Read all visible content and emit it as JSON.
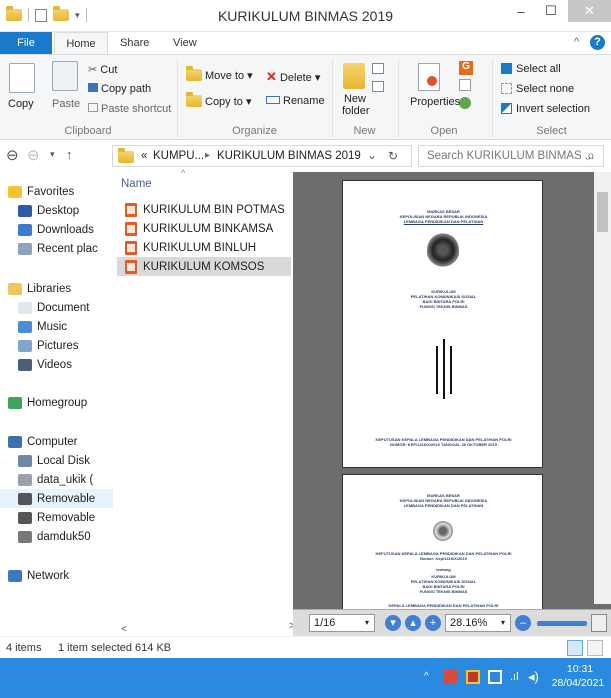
{
  "window": {
    "title": "KURIKULUM BINMAS 2019"
  },
  "title_controls": {
    "minimize": "–",
    "maximize": "☐",
    "close": "✕"
  },
  "ribbon_tabs": [
    "File",
    "Home",
    "Share",
    "View"
  ],
  "ribbon": {
    "clipboard": {
      "label": "Clipboard",
      "copy": "Copy",
      "paste": "Paste",
      "cut": "Cut",
      "copy_path": "Copy path",
      "paste_shortcut": "Paste shortcut"
    },
    "organize": {
      "label": "Organize",
      "move_to": "Move to ▾",
      "copy_to": "Copy to ▾",
      "delete": "Delete ▾",
      "rename": "Rename"
    },
    "new": {
      "label": "New",
      "new_folder_1": "New",
      "new_folder_2": "folder"
    },
    "open": {
      "label": "Open",
      "properties": "Properties"
    },
    "select": {
      "label": "Select",
      "select_all": "Select all",
      "select_none": "Select none",
      "invert": "Invert selection"
    }
  },
  "address": {
    "path_prefix": "«",
    "path_1": "KUMPU...",
    "path_arrow": "▸",
    "path_2": "KURIKULUM BINMAS 2019",
    "dropdown": "⌄",
    "refresh": "↻",
    "search_placeholder": "Search KURIKULUM BINMAS ...",
    "search_icon": "⌕"
  },
  "nav_buttons": {
    "back": "⊖",
    "forward": "⊖",
    "recent": "▾",
    "up": "↑"
  },
  "nav_pane": [
    {
      "label": "Favorites",
      "icon": "star-icon",
      "color": "#f4c430"
    },
    {
      "label": "Desktop",
      "icon": "desktop-icon",
      "color": "#2b5aa8"
    },
    {
      "label": "Downloads",
      "icon": "downloads-icon",
      "color": "#3a7bd5"
    },
    {
      "label": "Recent plac",
      "icon": "recent-places-icon",
      "color": "#8aa3bf"
    },
    {
      "label": "Libraries",
      "icon": "libraries-icon",
      "color": "#f2c55c"
    },
    {
      "label": "Document",
      "icon": "documents-icon",
      "color": "#dfe6ee"
    },
    {
      "label": "Music",
      "icon": "music-icon",
      "color": "#4b8bd8"
    },
    {
      "label": "Pictures",
      "icon": "pictures-icon",
      "color": "#7fa6cf"
    },
    {
      "label": "Videos",
      "icon": "videos-icon",
      "color": "#4a6077"
    },
    {
      "label": "Homegroup",
      "icon": "homegroup-icon",
      "color": "#3ba55c"
    },
    {
      "label": "Computer",
      "icon": "computer-icon",
      "color": "#3f6fae"
    },
    {
      "label": "Local Disk",
      "icon": "local-disk-icon",
      "color": "#6e88a5"
    },
    {
      "label": "data_ukik (",
      "icon": "drive-icon",
      "color": "#9aa3ad"
    },
    {
      "label": "Removable",
      "icon": "removable-drive-icon",
      "color": "#555"
    },
    {
      "label": "Removable",
      "icon": "removable-drive-icon",
      "color": "#555"
    },
    {
      "label": "damduk50",
      "icon": "phone-icon",
      "color": "#777"
    },
    {
      "label": "Network",
      "icon": "network-icon",
      "color": "#3c78c8"
    }
  ],
  "file_list": {
    "column_name": "Name",
    "sort_indicator": "^",
    "files": [
      "KURIKULUM BIN POTMAS",
      "KURIKULUM BINKAMSA",
      "KURIKULUM BINLUH",
      "KURIKULUM KOMSOS"
    ],
    "scroll_left": "<",
    "scroll_right": ">"
  },
  "preview": {
    "page1": {
      "header_1": "MARKAS BESAR",
      "header_2": "KEPOLISIAN NEGARA REPUBLIK INDONESIA",
      "header_3": "LEMBAGA PENDIDIKAN DAN PELATIHAN",
      "title_1": "KURIKULUM",
      "title_2": "PELATIHAN KOMUNIKASI SOSIAL",
      "title_3": "BAGI BINTARA POLRI",
      "title_4": "FUNGSI TEKNIS BINMAS",
      "footer_1": "KEPUTUSAN KEPALA LEMBAGA PENDIDIKAN DAN PELATIHAN POLRI",
      "footer_2": "NOMOR: KEP/1416/X/2019 TANGGAL 28 OKTOBER 2019"
    },
    "page2": {
      "header_1": "MARKAS BESAR",
      "header_2": "KEPOLISIAN NEGARA REPUBLIK INDONESIA",
      "header_3": "LEMBAGA PENDIDIKAN DAN PELATIHAN",
      "line_1": "KEPUTUSAN KEPALA LEMBAGA PENDIDIKAN DAN PELATIHAN POLRI",
      "line_2": "Nomor: Kep/1416/X/2019",
      "line_3": "tentang",
      "line_4": "KURIKULUM",
      "line_5": "PELATIHAN KOMUNIKASI SOSIAL",
      "line_6": "BAGI BINTARA POLRI",
      "line_7": "FUNGSI TEKNIS BINMAS",
      "line_8": "KEPALA LEMBAGA PENDIDIKAN DAN PELATIHAN POLRI"
    }
  },
  "pdf_toolbar": {
    "page": "1/16",
    "zoom": "28.16%"
  },
  "status": {
    "items": "4 items",
    "selected": "1 item selected  614 KB"
  },
  "taskbar": {
    "time": "10:31",
    "date": "28/04/2021",
    "tray_up": "^"
  }
}
